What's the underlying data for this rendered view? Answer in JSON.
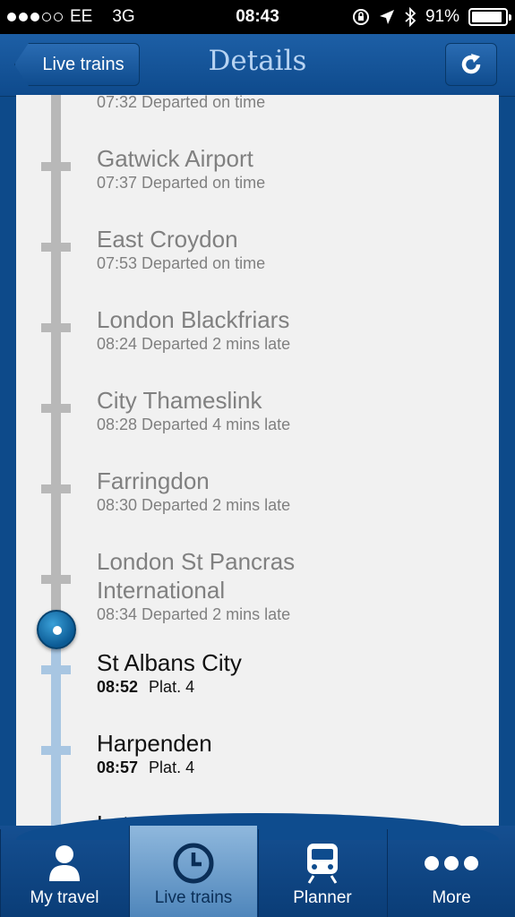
{
  "status_bar": {
    "carrier": "EE",
    "network": "3G",
    "time": "08:43",
    "battery": "91%",
    "battery_level": 0.91,
    "signal_bars_filled": 3,
    "signal_bars_total": 5
  },
  "navbar": {
    "back_label": "Live trains",
    "title": "Details"
  },
  "stops": [
    {
      "name": "",
      "status": "07:32 Departed on time",
      "state": "departed"
    },
    {
      "name": "Gatwick Airport",
      "status": "07:37 Departed on time",
      "state": "departed"
    },
    {
      "name": "East Croydon",
      "status": "07:53 Departed on time",
      "state": "departed"
    },
    {
      "name": "London Blackfriars",
      "status": "08:24 Departed 2 mins late",
      "state": "departed"
    },
    {
      "name": "City Thameslink",
      "status": "08:28 Departed 4 mins late",
      "state": "departed"
    },
    {
      "name": "Farringdon",
      "status": "08:30 Departed 2 mins late",
      "state": "departed"
    },
    {
      "name": "London St Pancras International",
      "status": "08:34 Departed 2 mins late",
      "state": "departed"
    },
    {
      "name": "St Albans City",
      "time": "08:52",
      "platform": "Plat. 4",
      "state": "upcoming"
    },
    {
      "name": "Harpenden",
      "time": "08:57",
      "platform": "Plat. 4",
      "state": "upcoming"
    },
    {
      "name": "Luton Airport Parkway",
      "state": "upcoming"
    }
  ],
  "tabs": [
    {
      "label": "My travel",
      "icon": "person-icon",
      "active": false
    },
    {
      "label": "Live trains",
      "icon": "clock-icon",
      "active": true
    },
    {
      "label": "Planner",
      "icon": "train-icon",
      "active": false
    },
    {
      "label": "More",
      "icon": "more-dots-icon",
      "active": false
    }
  ],
  "colors": {
    "brand_blue": "#0d4a8a",
    "departed_text": "#808080",
    "upcoming_text": "#111111",
    "track_past": "#b8b8b8",
    "track_future": "#a8c6e2"
  }
}
